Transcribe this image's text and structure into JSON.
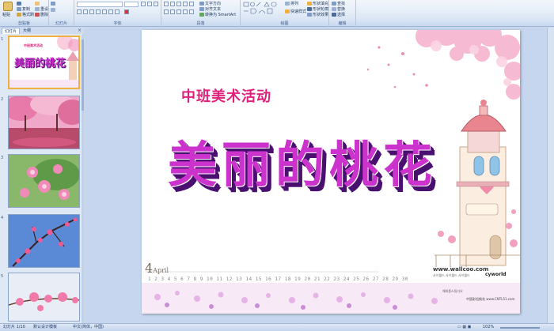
{
  "ribbon": {
    "groups": [
      {
        "label": "剪贴板"
      },
      {
        "label": "幻灯片"
      },
      {
        "label": "字体"
      },
      {
        "label": "段落"
      },
      {
        "label": "绘图"
      },
      {
        "label": "编辑"
      }
    ],
    "paste_label": "粘贴",
    "copy_label": "复制",
    "format_painter_label": "格式刷",
    "new_slide_label": "新建幻灯片",
    "reset_label": "重设",
    "delete_label": "删除",
    "text_direction_label": "文字方向",
    "align_text_label": "对齐文本",
    "convert_smartart_label": "转换为 SmartArt",
    "arrange_label": "排列",
    "quick_styles_label": "快速样式",
    "shape_fill_label": "形状填充",
    "shape_outline_label": "形状轮廓",
    "shape_effects_label": "形状效果",
    "find_label": "查找",
    "replace_label": "替换",
    "select_label": "选择"
  },
  "panel": {
    "tab_slides": "幻灯片",
    "tab_outline": "大纲",
    "close": "×",
    "thumbnail_numbers": [
      "1",
      "2",
      "3",
      "4",
      "5"
    ]
  },
  "slide": {
    "subtitle": "中班美术活动",
    "title": "美丽的桃花",
    "april_number": "4",
    "april_word": "April",
    "dates": "1 2 3 4 5 6 7 8 9 10 11 12 13 14 15 16 17 18 19 20 21 22 23 24 25 26 27 28 29 30",
    "wallcoo": "www.wallcoo.com",
    "wallcoo_sub": "사이월드 사이월드 사이월드",
    "cyworld": "cyworld",
    "credit": "中国彩铅桃花  www.CNTL51.com",
    "korean_small": "해외풍스튜디오"
  },
  "thumb1": {
    "subtitle": "中班美术活动",
    "title": "美丽的桃花"
  },
  "status": {
    "slide_count": "幻灯片 1/10",
    "theme": "默认设计模板",
    "language": "中文(简体，中国)",
    "zoom": "102%"
  },
  "colors": {
    "title": "#cc33cc",
    "title_shadow": "#4a1070",
    "subtitle": "#e0207a",
    "ribbon_bg": "#dce7f5",
    "selection": "#f0b040"
  }
}
